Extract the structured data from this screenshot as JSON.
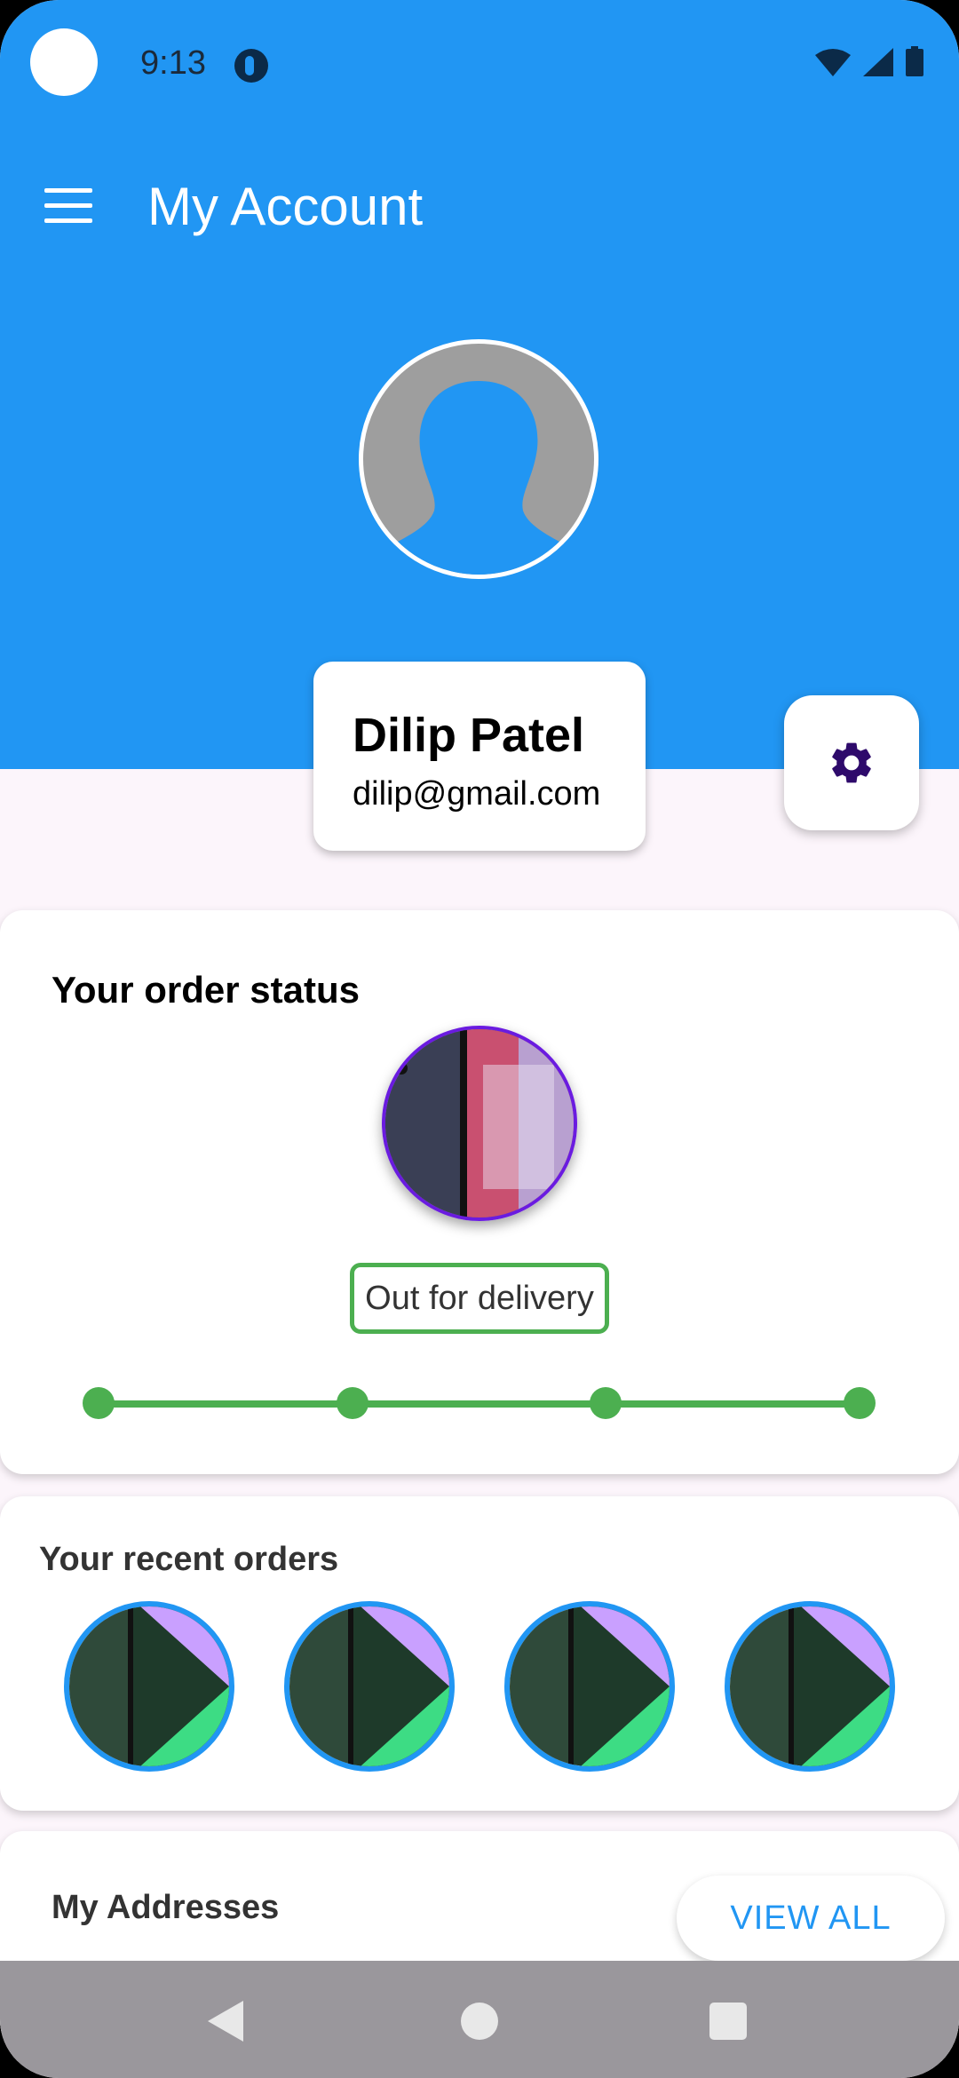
{
  "status_bar": {
    "time": "9:13"
  },
  "app_bar": {
    "title": "My Account"
  },
  "profile": {
    "name": "Dilip Patel",
    "email": "dilip@gmail.com"
  },
  "order_status": {
    "title": "Your order status",
    "status_label": "Out for delivery",
    "progress_steps_completed": 4,
    "progress_steps_total": 4
  },
  "recent_orders": {
    "title": "Your recent orders",
    "count": 4
  },
  "addresses": {
    "title": "My Addresses",
    "view_all_label": "VIEW ALL"
  },
  "icons": {
    "menu": "menu-icon",
    "settings": "gear-icon",
    "wifi": "wifi-icon",
    "signal": "signal-icon",
    "battery": "battery-icon",
    "back": "back-icon",
    "home": "home-icon",
    "recents": "recents-icon"
  },
  "colors": {
    "primary": "#2196F3",
    "status_green": "#4CAF50",
    "settings_icon": "#2E0A6B",
    "background": "#FCF5FB"
  }
}
